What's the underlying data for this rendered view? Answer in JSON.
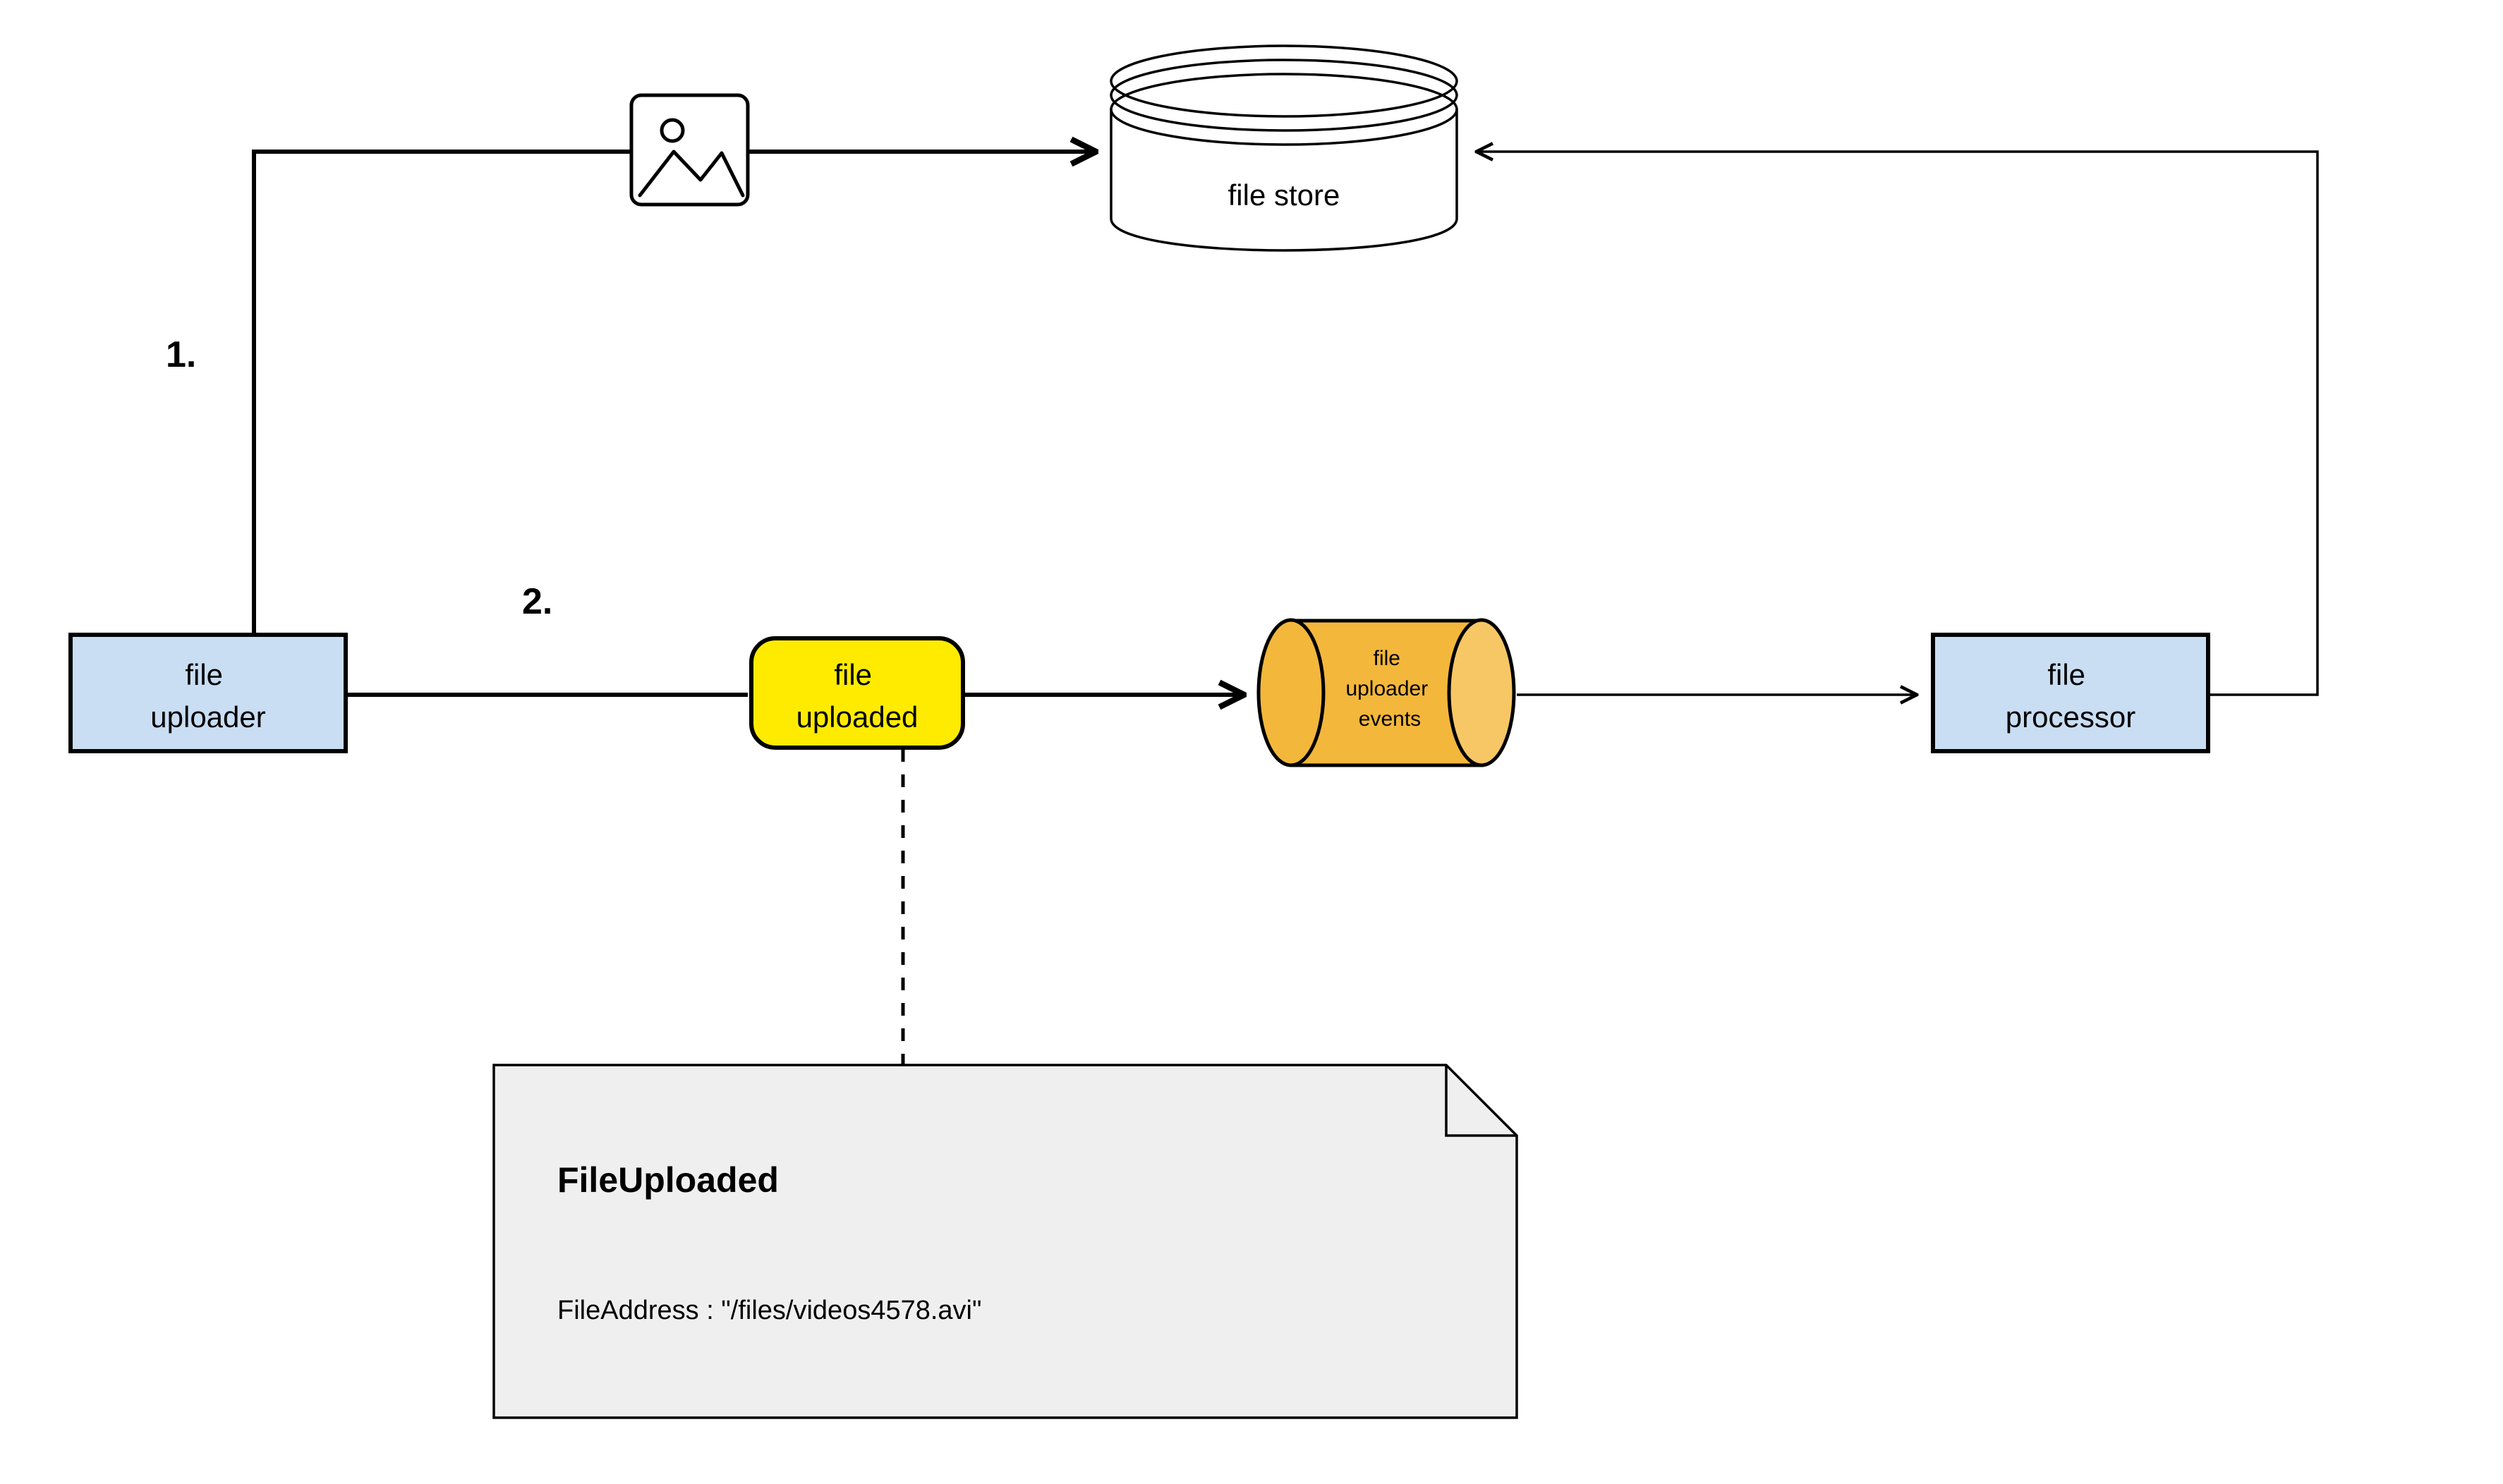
{
  "nodes": {
    "file_uploader": "file uploader",
    "file_store": "file store",
    "file_uploaded": "file uploaded",
    "file_uploader_events_l1": "file",
    "file_uploader_events_l2": "uploader",
    "file_uploader_events_l3": "events",
    "file_processor": "file processor"
  },
  "steps": {
    "one": "1.",
    "two": "2."
  },
  "note": {
    "title": "FileUploaded",
    "body": "FileAddress : \"/files/videos4578.avi\""
  }
}
